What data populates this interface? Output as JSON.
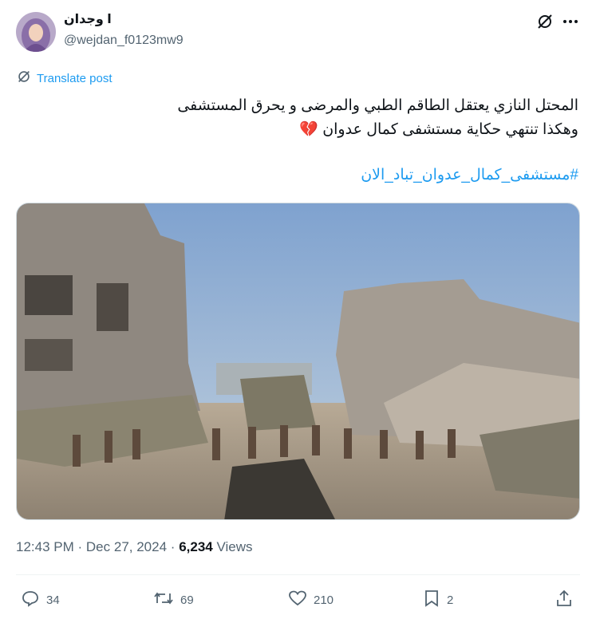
{
  "user": {
    "display_name": "ا وجدان",
    "handle": "@wejdan_f0123mw9"
  },
  "translate_label": "Translate post",
  "post": {
    "line1": "المحتل النازي  يعتقل الطاقم الطبي والمرضى و يحرق المستشفى",
    "line2": "وهكذا تنتهي حكاية مستشفى كمال عدوان",
    "line2_emoji": "💔",
    "hashtag": "#مستشفى_كمال_عدوان_تباد_الان"
  },
  "meta": {
    "time": "12:43 PM",
    "separator1": "·",
    "date": "Dec 27, 2024",
    "separator2": "·",
    "views_count": "6,234",
    "views_label": "Views"
  },
  "actions": {
    "replies": "34",
    "reposts": "69",
    "likes": "210",
    "bookmarks": "2"
  },
  "colors": {
    "accent": "#1d9bf0",
    "secondary_text": "#536471",
    "primary_text": "#0f1419"
  }
}
